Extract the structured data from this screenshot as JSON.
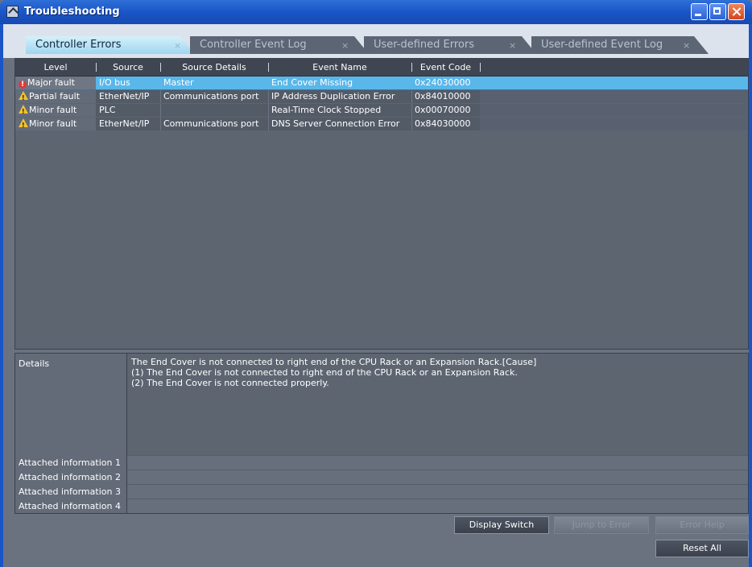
{
  "window": {
    "title": "Troubleshooting"
  },
  "tabs": [
    {
      "label": "Controller Errors",
      "close": "×",
      "active": true
    },
    {
      "label": "Controller Event Log",
      "close": "×",
      "active": false
    },
    {
      "label": "User-defined Errors",
      "close": "×",
      "active": false
    },
    {
      "label": "User-defined Event Log",
      "close": "×",
      "active": false
    }
  ],
  "grid": {
    "columns": [
      "Level",
      "Source",
      "Source Details",
      "Event Name",
      "Event Code"
    ],
    "rows": [
      {
        "level": "Major fault",
        "level_icon": "error-icon",
        "source": "I/O bus",
        "source_details": "Master",
        "event_name": "End Cover Missing",
        "event_code": "0x24030000",
        "selected": true
      },
      {
        "level": "Partial fault",
        "level_icon": "warning-icon",
        "source": "EtherNet/IP",
        "source_details": "Communications port",
        "event_name": "IP Address Duplication Error",
        "event_code": "0x84010000",
        "selected": false
      },
      {
        "level": "Minor fault",
        "level_icon": "warning-icon",
        "source": "PLC",
        "source_details": "",
        "event_name": "Real-Time Clock Stopped",
        "event_code": "0x00070000",
        "selected": false
      },
      {
        "level": "Minor fault",
        "level_icon": "warning-icon",
        "source": "EtherNet/IP",
        "source_details": "Communications port",
        "event_name": "DNS Server Connection Error",
        "event_code": "0x84030000",
        "selected": false
      }
    ]
  },
  "details": {
    "label": "Details",
    "text_lines": [
      "The End Cover is not connected to right end of the CPU Rack or an Expansion Rack.[Cause]",
      "(1) The End Cover is not connected to right end of the CPU Rack or an Expansion Rack.",
      "(2) The End Cover is not connected properly."
    ],
    "attached": [
      {
        "label": "Attached information 1",
        "value": ""
      },
      {
        "label": "Attached information 2",
        "value": ""
      },
      {
        "label": "Attached information 3",
        "value": ""
      },
      {
        "label": "Attached information 4",
        "value": ""
      }
    ]
  },
  "buttons": {
    "display_switch": "Display Switch",
    "jump_to_error": "Jump to Error",
    "error_help": "Error Help",
    "reset_all": "Reset All"
  },
  "colors": {
    "title_bar": "#1a55c8",
    "selected_row": "#59b7ea",
    "active_tab": "#c4e8f6",
    "panel_bg": "#5d6571"
  }
}
